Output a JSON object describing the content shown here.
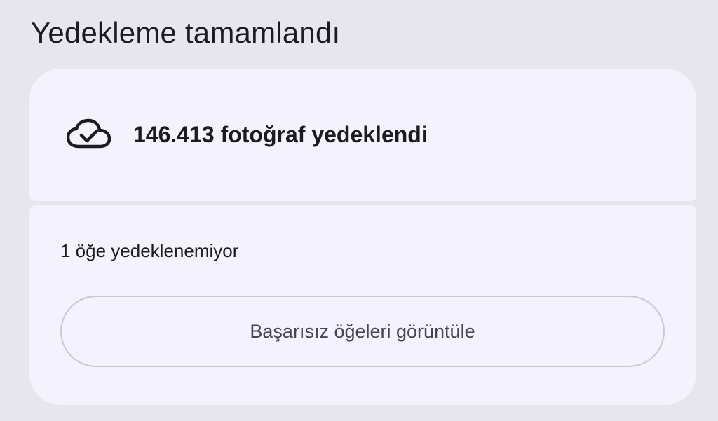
{
  "title": "Yedekleme tamamlandı",
  "backup_status": {
    "icon": "cloud-check-icon",
    "label": "146.413 fotoğraf yedeklendi"
  },
  "failed_section": {
    "message": "1 öğe yedeklenemiyor",
    "button_label": "Başarısız öğeleri görüntüle"
  },
  "colors": {
    "background": "#e7e6ef",
    "card": "#f3f2fd",
    "text": "#1d1b20",
    "button_border": "#c9c7d0",
    "button_text": "#46444f"
  }
}
